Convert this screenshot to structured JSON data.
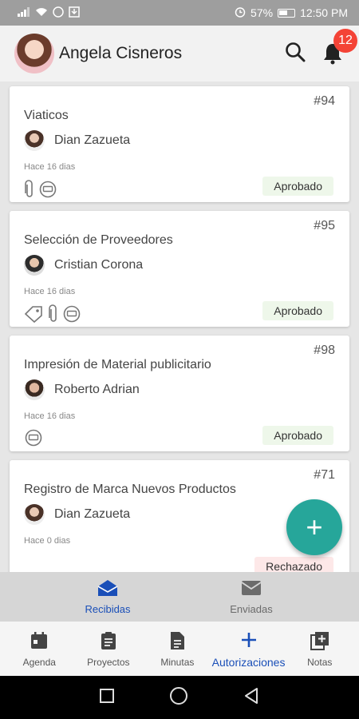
{
  "status_bar": {
    "battery": "57%",
    "time": "12:50 PM"
  },
  "header": {
    "user_name": "Angela Cisneros",
    "notification_count": "12"
  },
  "cards": [
    {
      "id": "#94",
      "title": "Viaticos",
      "person": "Dian Zazueta",
      "time": "Hace 16 dias",
      "status": "Aprobado",
      "icons": [
        "paperclip-icon",
        "chat-icon"
      ]
    },
    {
      "id": "#95",
      "title": "Selección de Proveedores",
      "person": "Cristian Corona",
      "time": "Hace 16 dias",
      "status": "Aprobado",
      "icons": [
        "tag-icon",
        "paperclip-icon",
        "chat-icon"
      ]
    },
    {
      "id": "#98",
      "title": "Impresión de Material publicitario",
      "person": "Roberto Adrian",
      "time": "Hace 16 dias",
      "status": "Aprobado",
      "icons": [
        "chat-icon"
      ]
    },
    {
      "id": "#71",
      "title": "Registro de Marca Nuevos Productos",
      "person": "Dian Zazueta",
      "time": "Hace 0 dias",
      "status": "Rechazado",
      "icons": []
    }
  ],
  "fab": {
    "label": "+"
  },
  "sub_tabs": [
    {
      "label": "Recibidas",
      "active": true
    },
    {
      "label": "Enviadas",
      "active": false
    }
  ],
  "bottom_nav": [
    {
      "label": "Agenda"
    },
    {
      "label": "Proyectos"
    },
    {
      "label": "Minutas"
    },
    {
      "label": "Autorizaciones",
      "active": true
    },
    {
      "label": "Notas"
    }
  ],
  "colors": {
    "accent": "#1a4fb8",
    "fab": "#26a69a",
    "badge": "#f44336"
  }
}
